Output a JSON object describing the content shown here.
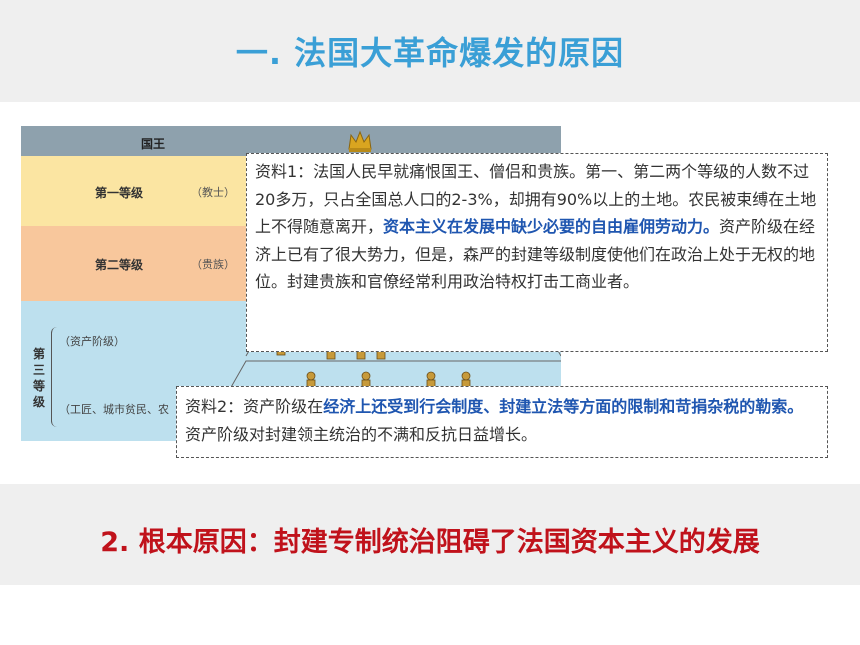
{
  "header": {
    "title": "一. 法国大革命爆发的原因"
  },
  "diagram": {
    "king_label": "国王",
    "first_estate_label": "第一等级",
    "first_estate_sub": "（教士）",
    "second_estate_label": "第二等级",
    "second_estate_sub": "（贵族）",
    "third_estate_label": "第三等级",
    "bourgeoisie_label": "（资产阶级）",
    "workers_label": "（工匠、城市贫民、农"
  },
  "material1": {
    "prefix": "资料1：法国人民早就痛恨国王、僧侣和贵族。第一、第二两个等级的人数不过20多万，只占全国总人口的2-3%，却拥有90%以上的土地。农民被束缚在土地上不得随意离开，",
    "highlight": "资本主义在发展中缺少必要的自由雇佣劳动力。",
    "suffix": "资产阶级在经济上已有了很大势力，但是，森严的封建等级制度使他们在政治上处于无权的地位。封建贵族和官僚经常利用政治特权打击工商业者。"
  },
  "material2": {
    "prefix": "资料2：资产阶级在",
    "highlight": "经济上还受到行会制度、封建立法等方面的限制和苛捐杂税的勒索。",
    "suffix": "资产阶级对封建领主统治的不满和反抗日益增长。"
  },
  "conclusion": {
    "text": "2. 根本原因：封建专制统治阻碍了法国资本主义的发展"
  },
  "colors": {
    "title": "#3a9fd6",
    "highlight": "#1f56b0",
    "conclusion": "#c0121b",
    "band": "#efefef"
  }
}
